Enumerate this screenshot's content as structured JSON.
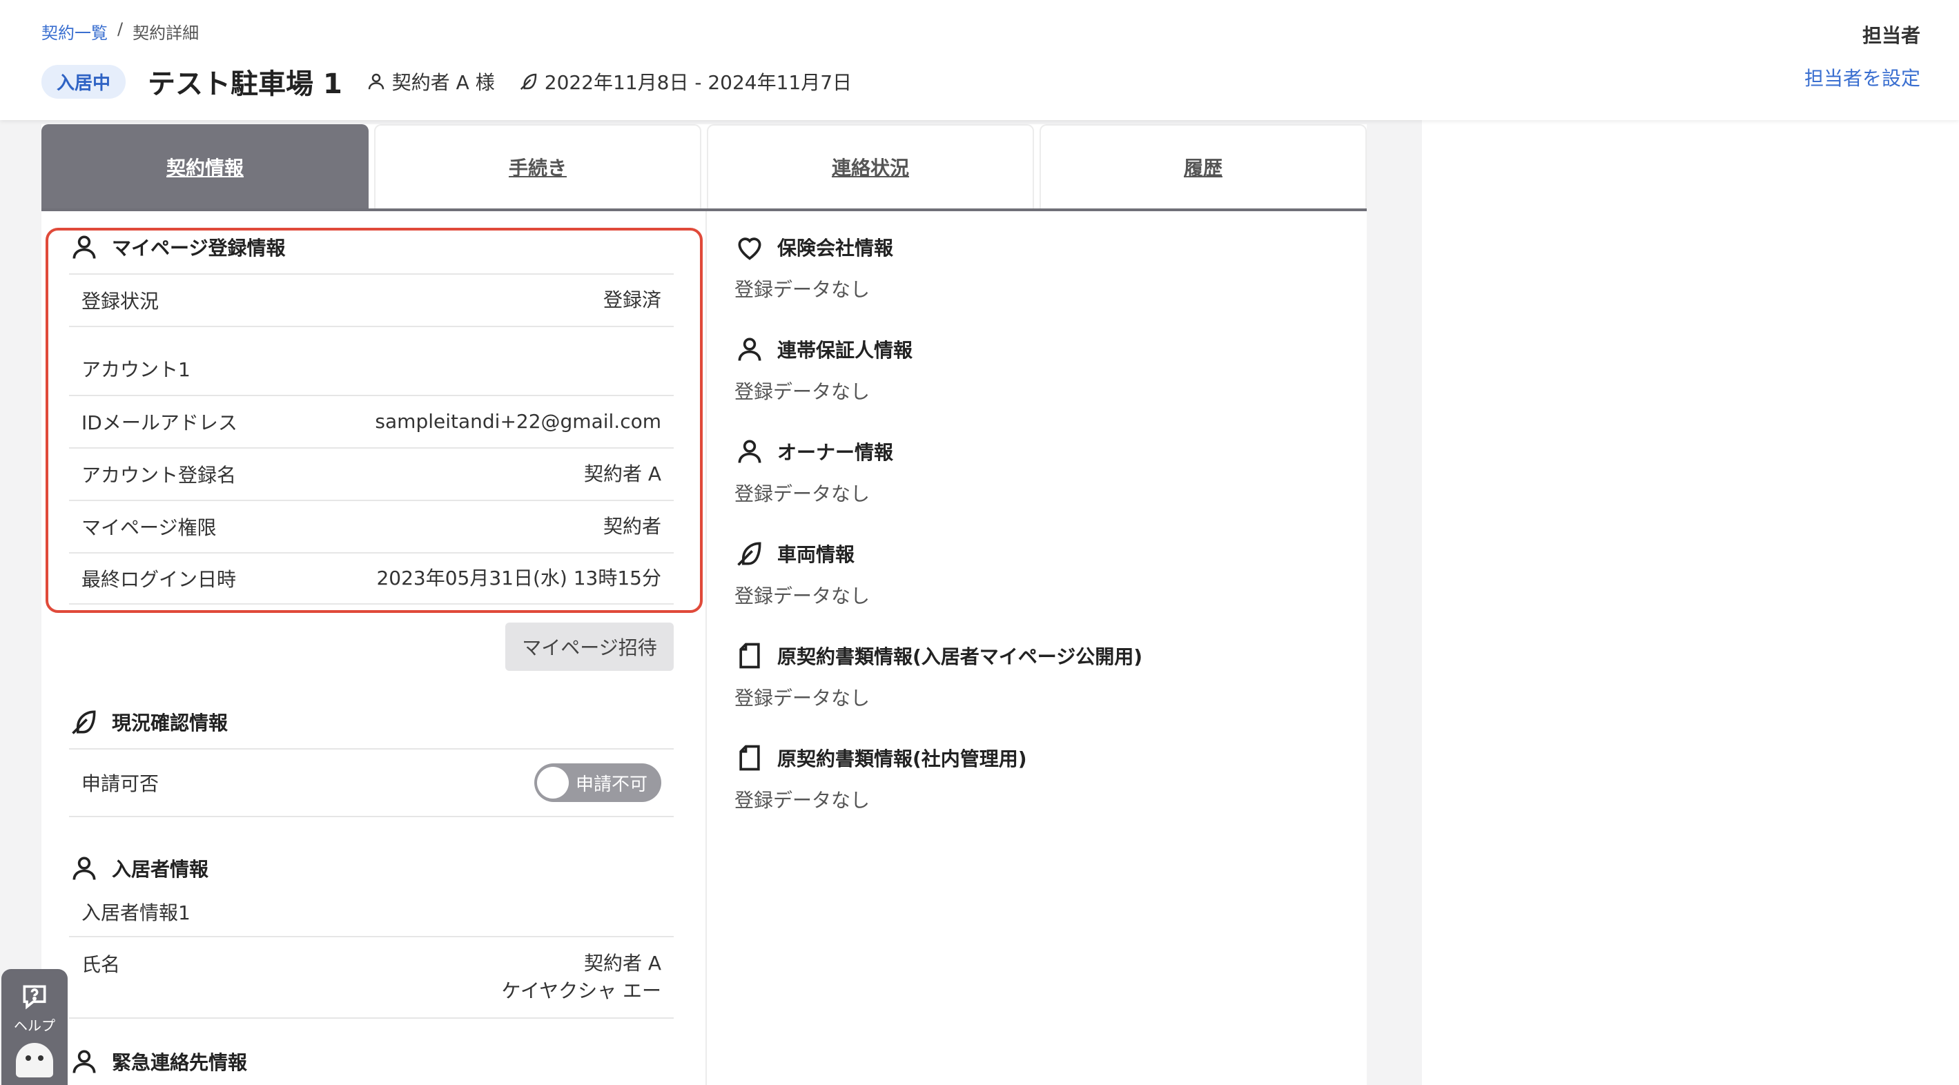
{
  "breadcrumb": {
    "parent": "契約一覧",
    "separator": "/",
    "current": "契約詳細"
  },
  "header": {
    "status_badge": "入居中",
    "property_name": "テスト駐車場 1",
    "contractor": "契約者 A 様",
    "period": "2022年11月8日 - 2024年11月7日",
    "assignee_label": "担当者",
    "assignee_link": "担当者を設定"
  },
  "tabs": [
    {
      "label": "契約情報",
      "active": true
    },
    {
      "label": "手続き"
    },
    {
      "label": "連絡状況"
    },
    {
      "label": "履歴"
    }
  ],
  "mypage": {
    "title": "マイページ登録情報",
    "status_label": "登録状況",
    "status_value": "登録済",
    "account_heading": "アカウント1",
    "email_label": "IDメールアドレス",
    "email_value": "sampleitandi+22@gmail.com",
    "account_name_label": "アカウント登録名",
    "account_name_value": "契約者 A",
    "permission_label": "マイページ権限",
    "permission_value": "契約者",
    "last_login_label": "最終ログイン日時",
    "last_login_value": "2023年05月31日(水) 13時15分",
    "invite_button": "マイページ招待"
  },
  "status_check": {
    "title": "現況確認情報",
    "apply_label": "申請可否",
    "toggle_label": "申請不可"
  },
  "resident": {
    "title": "入居者情報",
    "subheading": "入居者情報1",
    "name_label": "氏名",
    "name_value": "契約者 A",
    "name_kana": "ケイヤクシャ エー"
  },
  "emergency": {
    "title": "緊急連絡先情報"
  },
  "right_sections": [
    {
      "title": "保険会社情報",
      "icon": "heart-icon",
      "empty": "登録データなし"
    },
    {
      "title": "連帯保証人情報",
      "icon": "person-icon",
      "empty": "登録データなし"
    },
    {
      "title": "オーナー情報",
      "icon": "person-icon",
      "empty": "登録データなし"
    },
    {
      "title": "車両情報",
      "icon": "feather-icon",
      "empty": "登録データなし"
    },
    {
      "title": "原契約書類情報(入居者マイページ公開用)",
      "icon": "document-icon",
      "empty": "登録データなし"
    },
    {
      "title": "原契約書類情報(社内管理用)",
      "icon": "document-icon",
      "empty": "登録データなし"
    }
  ],
  "help": {
    "label": "ヘルプ"
  },
  "colors": {
    "accent": "#3a6fd0",
    "highlight": "#e04a3a",
    "tab_active": "#75757d"
  }
}
